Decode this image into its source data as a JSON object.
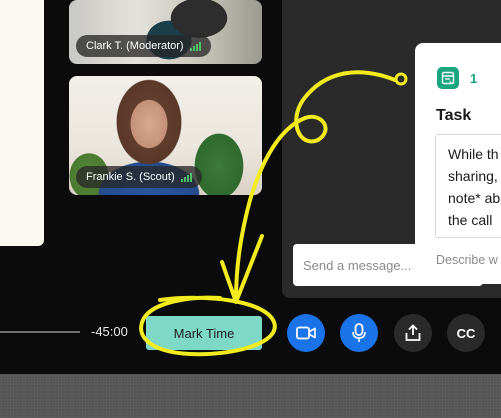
{
  "participants": [
    {
      "name": "Clark T. (Moderator)"
    },
    {
      "name": "Frankie S. (Scout)"
    }
  ],
  "chat": {
    "input_placeholder": "Send a message..."
  },
  "task_card": {
    "count": "1",
    "title": "Task",
    "body_lines": [
      "While th",
      "sharing,",
      "note* ab",
      "the call"
    ],
    "description_placeholder": "Describe w"
  },
  "controls": {
    "timer": "-45:00",
    "mark_time_label": "Mark Time",
    "cc_label": "CC"
  },
  "colors": {
    "accent_blue": "#1a73e8",
    "mark_time_bg": "#7ed8c6",
    "task_green": "#18a57f",
    "annotation_yellow": "#f2ec1e"
  }
}
